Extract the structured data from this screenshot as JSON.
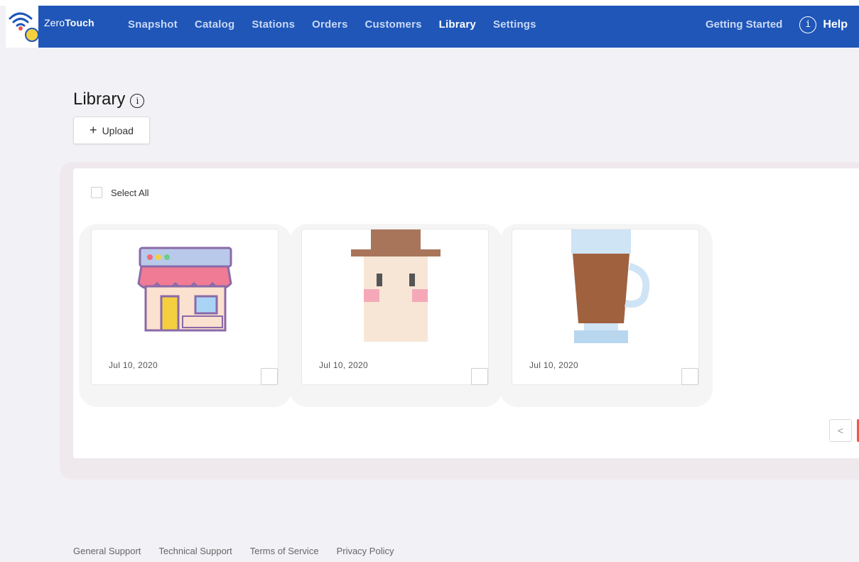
{
  "app": {
    "brand_prefix": "Zero",
    "brand_suffix": "Touch"
  },
  "nav": {
    "items": [
      {
        "label": "Snapshot"
      },
      {
        "label": "Catalog"
      },
      {
        "label": "Stations"
      },
      {
        "label": "Orders"
      },
      {
        "label": "Customers"
      },
      {
        "label": "Library",
        "active": true
      },
      {
        "label": "Settings"
      }
    ],
    "getting_started": "Getting Started",
    "help_label": "Help",
    "help_icon_glyph": "i"
  },
  "page": {
    "title": "Library",
    "info_glyph": "i",
    "upload_plus": "+",
    "upload_label": "Upload"
  },
  "library": {
    "select_all_label": "Select All",
    "items": [
      {
        "icon": "storefront-icon",
        "date": "Jul 10, 2020"
      },
      {
        "icon": "person-hat-icon",
        "date": "Jul 10, 2020"
      },
      {
        "icon": "coffee-glass-icon",
        "date": "Jul 10, 2020"
      }
    ],
    "pager_prev_glyph": "<"
  },
  "footer": {
    "links": [
      "General Support",
      "Technical Support",
      "Terms of Service",
      "Privacy Policy"
    ]
  },
  "colors": {
    "navbar": "#1f56b8",
    "nav_text": "#c9d8f5",
    "accent_red": "#e8584f",
    "page_bg": "#f2f1f5"
  }
}
